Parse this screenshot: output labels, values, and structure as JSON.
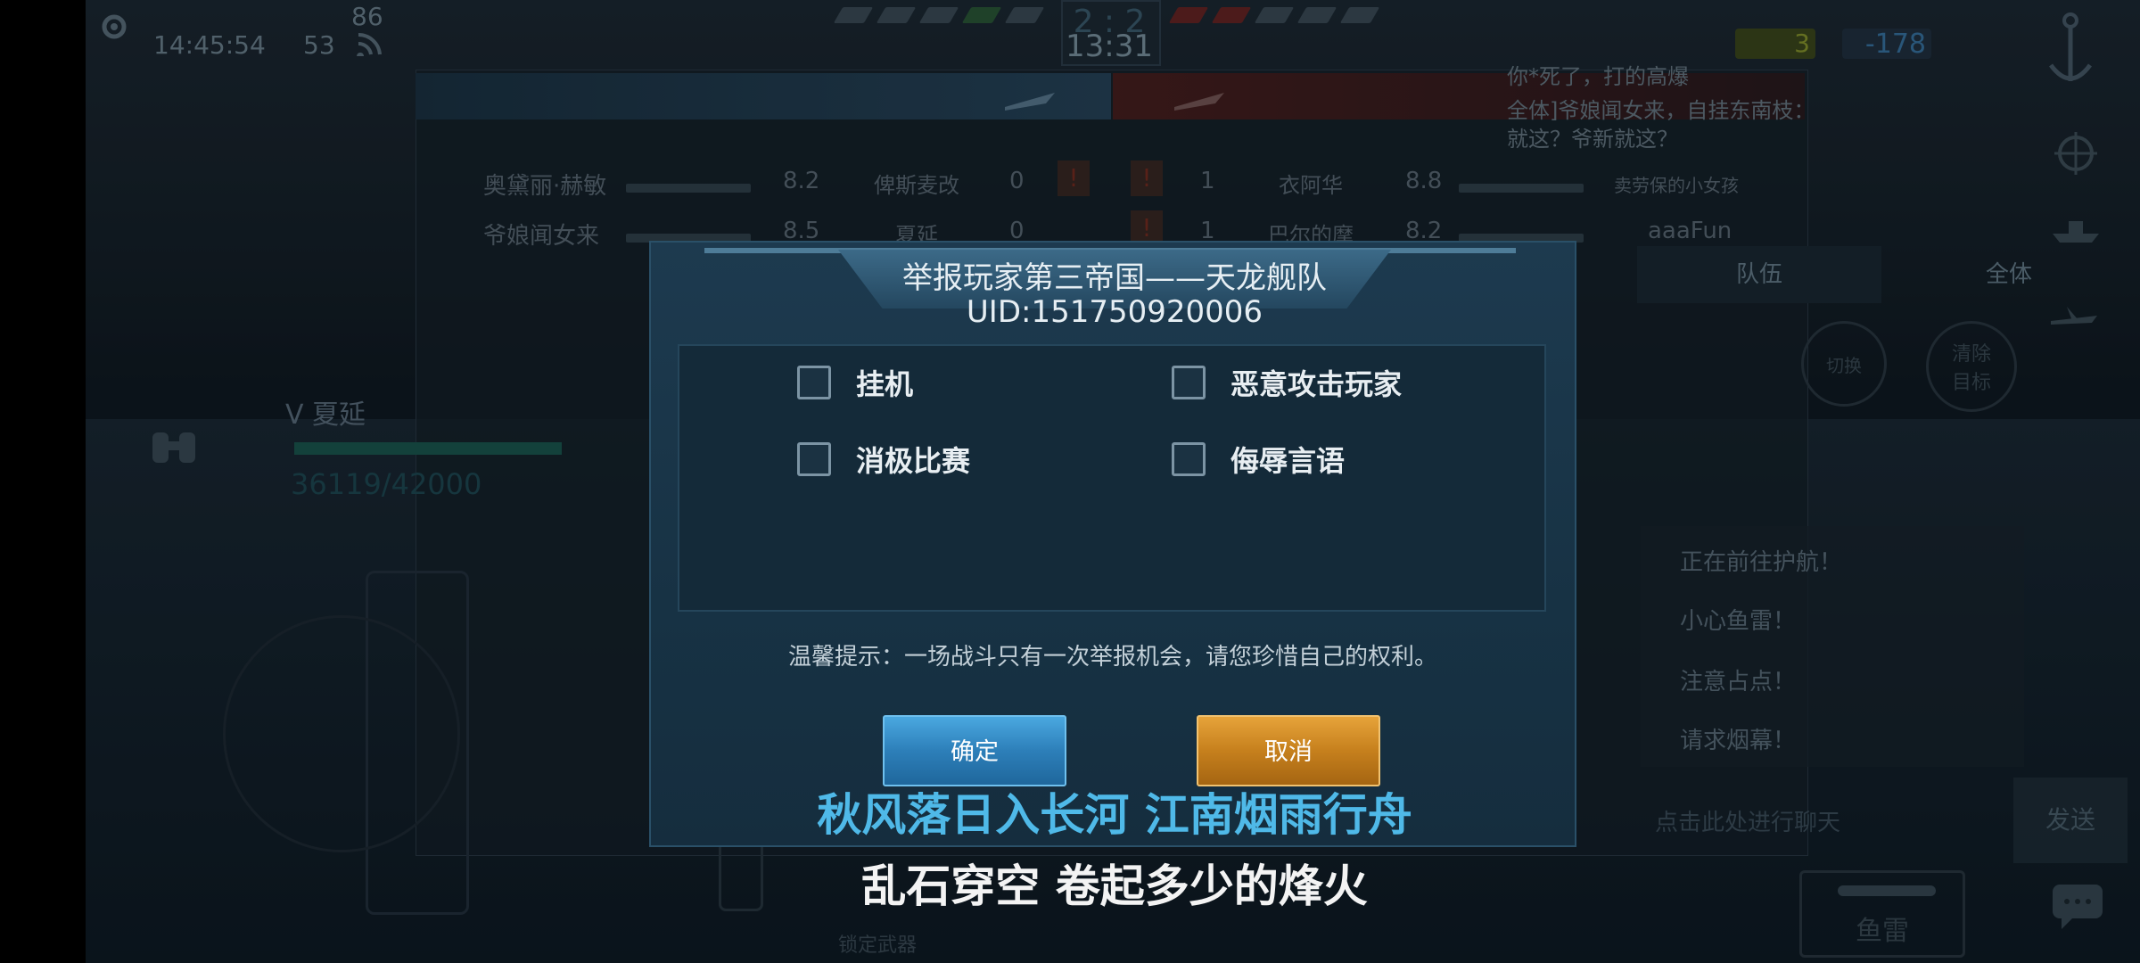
{
  "hud": {
    "clock": "14:45:54",
    "ping": "53",
    "fps": "86",
    "score": "2 : 2",
    "match_timer": "13:31",
    "self_score": "3",
    "enemy_score": "-178"
  },
  "scoreboard": {
    "ally_rows": [
      {
        "name": "奥黛丽·赫敏",
        "ship_level": "8.2",
        "ship": "俾斯麦改",
        "kills": "0"
      },
      {
        "name": "爷娘闻女来",
        "ship_level": "8.5",
        "ship": "夏延",
        "kills": "0"
      }
    ],
    "enemy_rows": [
      {
        "kills": "1",
        "ship": "衣阿华",
        "ship_level": "8.8",
        "name": "卖劳保的小女孩"
      },
      {
        "kills": "1",
        "ship": "巴尔的摩",
        "ship_level": "8.2",
        "name": "aaaFun"
      }
    ]
  },
  "chat": {
    "line1": "你*死了，打的高爆",
    "line2": "全体]爷娘闻女来，自挂东南枝：",
    "line3": "就这？爷新就这？",
    "tab_team": "队伍",
    "tab_all": "全体",
    "input_placeholder": "点击此处进行聊天",
    "send_label": "发送"
  },
  "quick_messages": [
    "正在前往护航！",
    "小心鱼雷！",
    "注意占点！",
    "请求烟幕！"
  ],
  "player": {
    "ship_name": "V 夏延",
    "hp": "36119/42000"
  },
  "weapons": {
    "lock_label": "锁定武器",
    "torpedo_label": "鱼雷",
    "switch_label": "切换",
    "clear_target_label": "清除目标"
  },
  "dialog": {
    "title": "举报玩家第三帝国——天龙舰队",
    "uid": "UID:151750920006",
    "options": [
      {
        "label": "挂机",
        "checked": false
      },
      {
        "label": "恶意攻击玩家",
        "checked": false
      },
      {
        "label": "消极比赛",
        "checked": false
      },
      {
        "label": "侮辱言语",
        "checked": false
      }
    ],
    "tip": "温馨提示：一场战斗只有一次举报机会，请您珍惜自己的权利。",
    "confirm_label": "确定",
    "cancel_label": "取消"
  },
  "lyrics": {
    "line1": "秋风落日入长河 江南烟雨行舟",
    "line2": "乱石穿空 卷起多少的烽火"
  },
  "colors": {
    "confirm": "#2d7fb9",
    "cancel": "#c6801d",
    "lyric_blue": "#4fb9e8",
    "ally": "#3c6a88",
    "enemy": "#8a2a2a"
  }
}
